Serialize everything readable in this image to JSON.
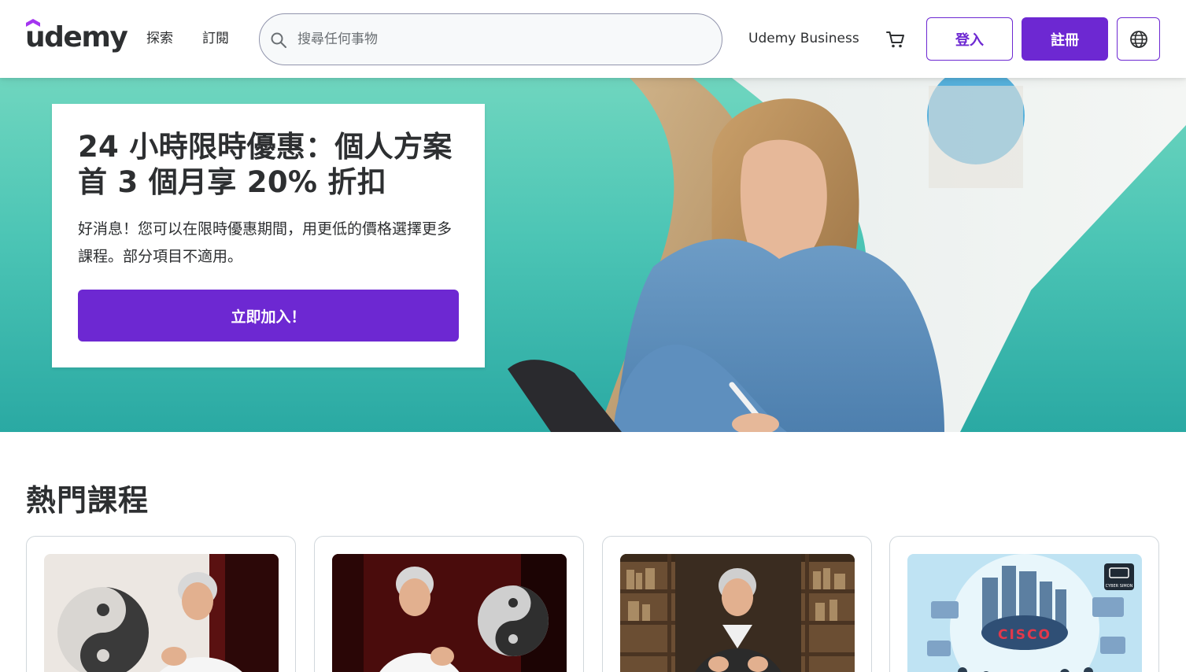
{
  "brand": {
    "logo_text": "udemy",
    "accent": "#6d28d2"
  },
  "header": {
    "nav": {
      "explore": "探索",
      "subscribe": "訂閱"
    },
    "search": {
      "placeholder": "搜尋任何事物",
      "icon": "search-icon"
    },
    "business_link": "Udemy Business",
    "cart_icon": "cart-icon",
    "login_label": "登入",
    "signup_label": "註冊",
    "language_icon": "globe-icon"
  },
  "hero": {
    "title": "24 小時限時優惠：個人方案首 3 個月享 20% 折扣",
    "description": "好消息！您可以在限時優惠期間，用更低的價格選擇更多課程。部分項目不適用。",
    "cta_label": "立即加入！"
  },
  "popular": {
    "title": "熱門課程",
    "courses": [
      {
        "thumb_text": ""
      },
      {
        "thumb_text": ""
      },
      {
        "thumb_text": ""
      },
      {
        "thumb_text": "CISCO",
        "badge_text": "CYBER SIMON"
      }
    ]
  }
}
